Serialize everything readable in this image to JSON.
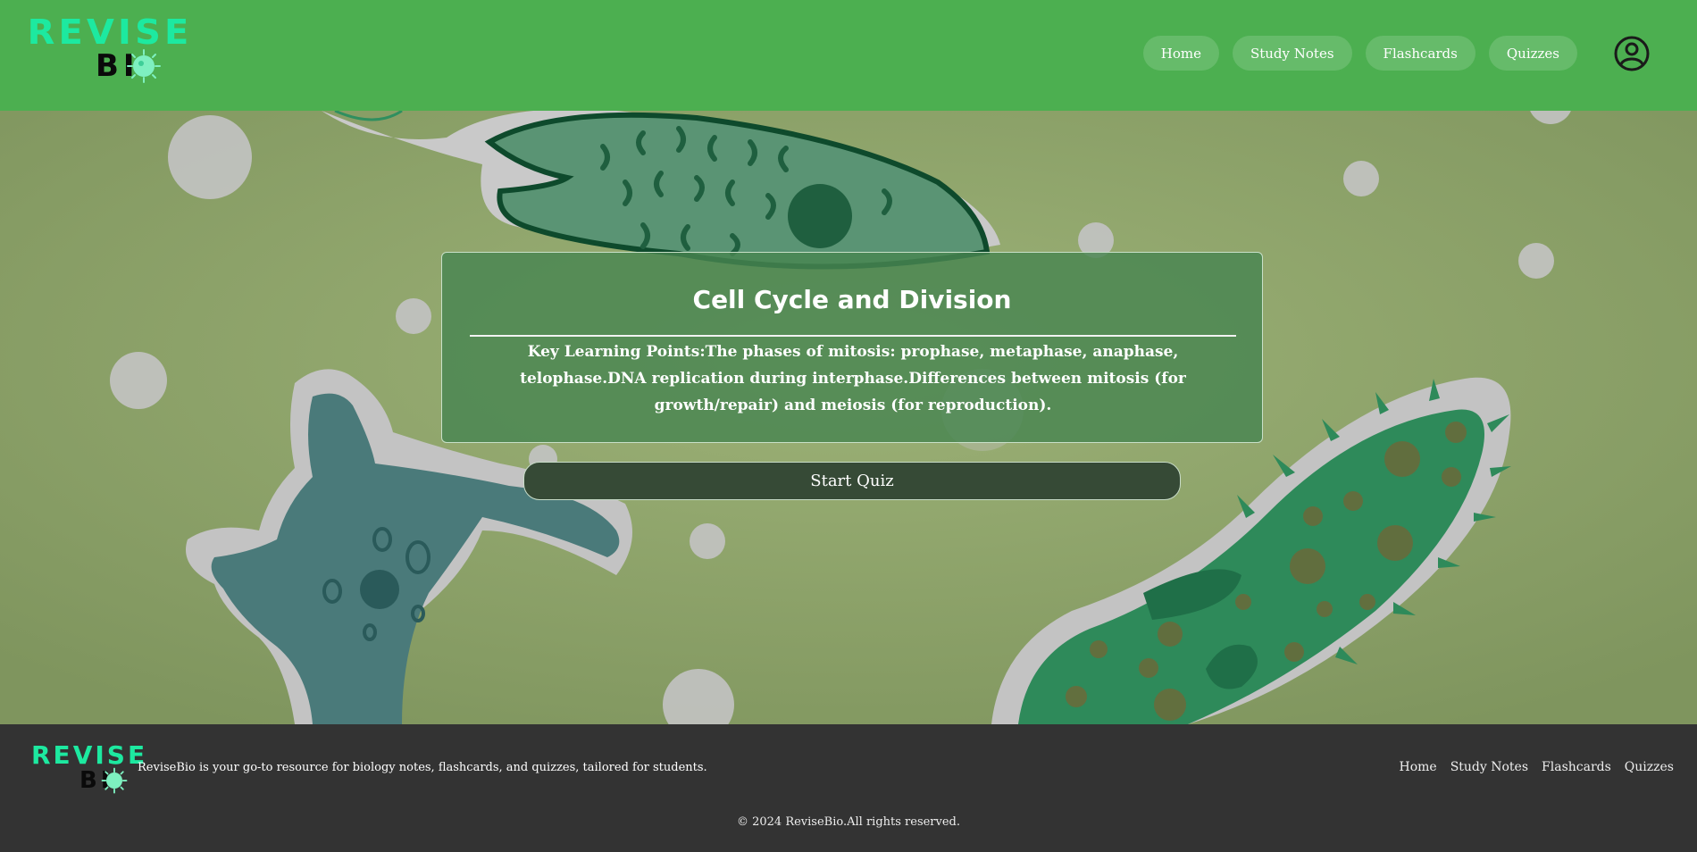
{
  "header": {
    "logo_top": "REVISE",
    "logo_bottom": "BI",
    "nav": [
      {
        "label": "Home"
      },
      {
        "label": "Study Notes"
      },
      {
        "label": "Flashcards"
      },
      {
        "label": "Quizzes"
      }
    ],
    "user_icon": "user-circle-icon"
  },
  "main": {
    "title": "Cell Cycle and Division",
    "key_points": "Key Learning Points:The phases of mitosis: prophase, metaphase, anaphase, telophase.DNA replication during interphase.Differences between mitosis (for growth/repair) and meiosis (for reproduction).",
    "start_button": "Start Quiz"
  },
  "footer": {
    "logo_top": "REVISE",
    "logo_bottom": "BI",
    "description": "ReviseBio is your go-to resource for biology notes, flashcards, and quizzes, tailored for students.",
    "links": [
      {
        "label": "Home"
      },
      {
        "label": "Study Notes"
      },
      {
        "label": "Flashcards"
      },
      {
        "label": "Quizzes"
      }
    ],
    "copyright": "© 2024 ReviseBio.All rights reserved."
  },
  "colors": {
    "header_bg": "#4caf50",
    "nav_button_bg": "#66bb6a",
    "logo_accent": "#1de9a0",
    "footer_bg": "#333333",
    "card_bg": "#488550",
    "start_button_bg": "#364a36"
  }
}
